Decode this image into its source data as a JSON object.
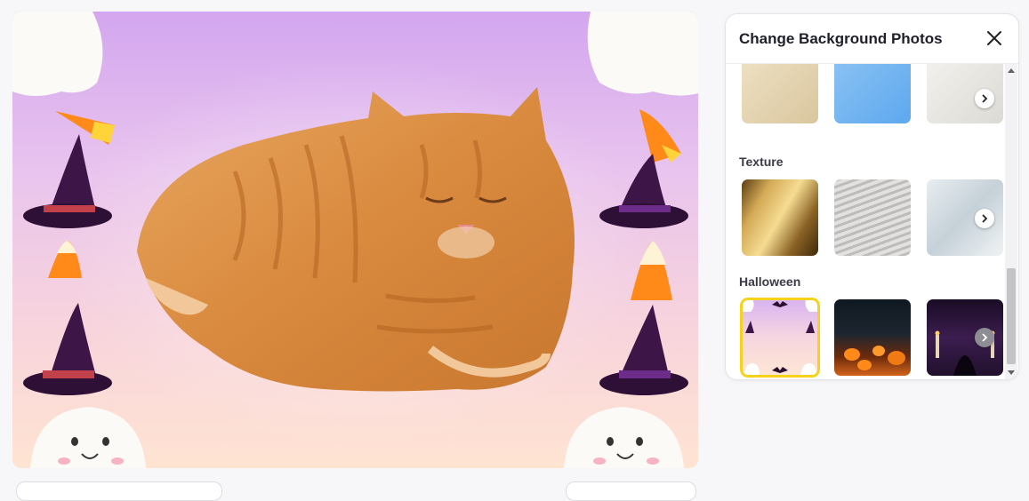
{
  "panel": {
    "title": "Change Background Photos",
    "close_icon": "close-icon",
    "sections": [
      {
        "title": "",
        "items": [
          "beige paper",
          "blue paper",
          "white paper"
        ]
      },
      {
        "title": "Texture",
        "items": [
          "gold foil",
          "gray waves",
          "white marble"
        ]
      },
      {
        "title": "Halloween",
        "items": [
          "cute halloween frame",
          "pumpkin field",
          "dark candle altar"
        ],
        "selected_index": 0
      }
    ]
  },
  "colors": {
    "selected_outline": "#f7d21c",
    "canvas_gradient_top": "#d3a6ef",
    "canvas_gradient_bottom": "#ffe4d2"
  }
}
